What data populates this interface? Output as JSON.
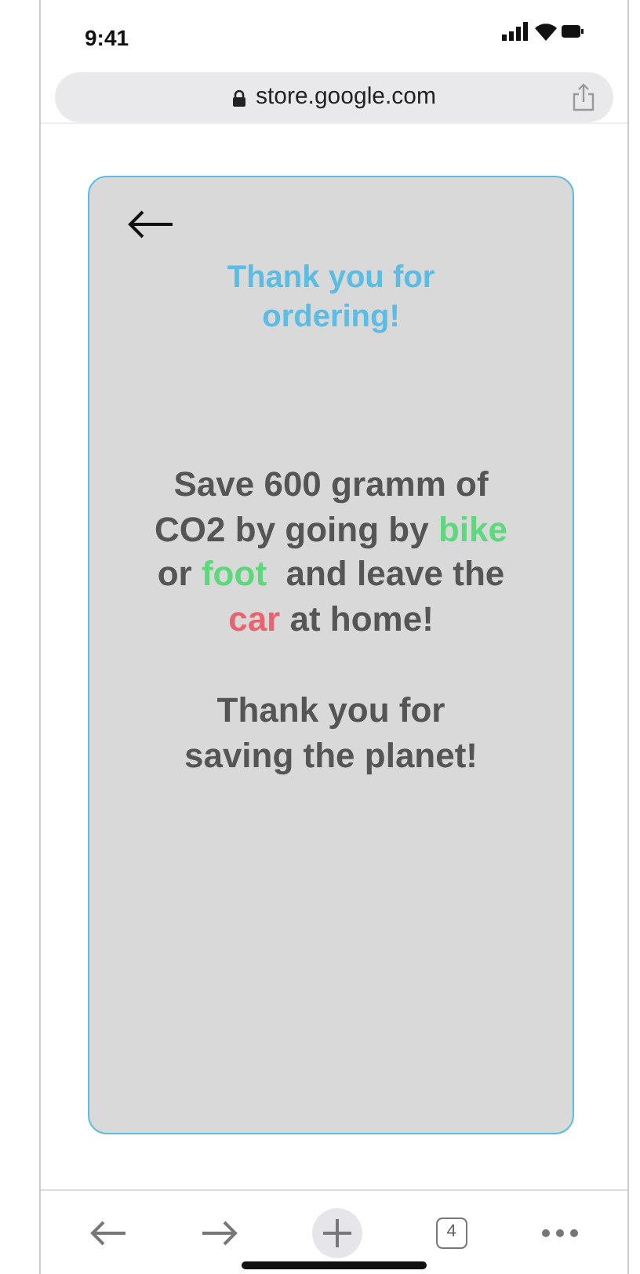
{
  "status_bar": {
    "time": "9:41"
  },
  "address_bar": {
    "url": "store.google.com"
  },
  "card": {
    "title": "Thank you for ordering!",
    "message": [
      {
        "segments": [
          {
            "text": "Save 600 gramm of CO2 by going by "
          },
          {
            "text": "bike",
            "color": "#5ed87c"
          },
          {
            "text": " or "
          },
          {
            "text": "foot",
            "color": "#5ed87c"
          },
          {
            "text": "  and leave the "
          },
          {
            "text": "car",
            "color": "#ea6470"
          },
          {
            "text": " at home!"
          }
        ]
      },
      {
        "segments": [
          {
            "text": "Thank you for saving the planet!"
          }
        ]
      }
    ]
  },
  "toolbar": {
    "tab_count": "4"
  }
}
